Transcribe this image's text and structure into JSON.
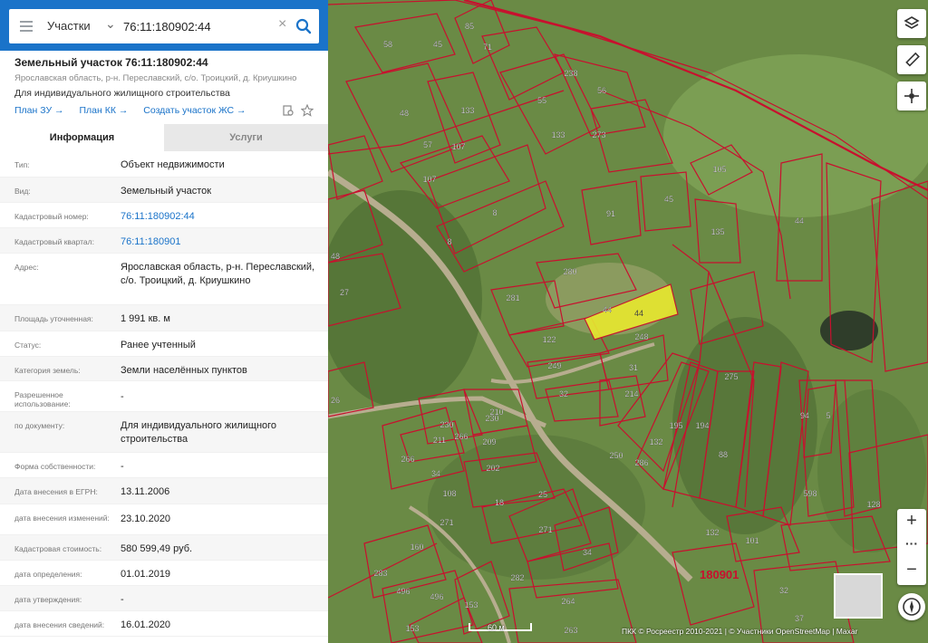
{
  "search": {
    "type_label": "Участки",
    "value": "76:11:180902:44"
  },
  "object": {
    "title": "Земельный участок 76:11:180902:44",
    "address": "Ярославская область, р-н. Переславский, с/о. Троицкий, д. Криушкино",
    "purpose": "Для индивидуального жилищного строительства",
    "links": [
      "План ЗУ →",
      "План КК →",
      "Создать участок ЖС →"
    ]
  },
  "tabs": {
    "info": "Информация",
    "services": "Услуги"
  },
  "rows": [
    {
      "key": "Тип:",
      "value": "Объект недвижимости"
    },
    {
      "key": "Вид:",
      "value": "Земельный участок"
    },
    {
      "key": "Кадастровый номер:",
      "value": "76:11:180902:44"
    },
    {
      "key": "Кадастровый квартал:",
      "value": "76:11:180901"
    },
    {
      "key": "Адрес:",
      "value": "Ярославская область, р-н. Переславский, с/о. Троицкий, д. Криушкино"
    },
    {
      "key": "Площадь уточненная:",
      "value": "1 991 кв. м"
    },
    {
      "key": "Статус:",
      "value": "Ранее учтенный"
    },
    {
      "key": "Категория земель:",
      "value": "Земли населённых пунктов"
    },
    {
      "key": "Разрешенное использование:",
      "value": "-"
    },
    {
      "key": "по документу:",
      "value": "Для индивидуального жилищного строительства"
    },
    {
      "key": "Форма собственности:",
      "value": "-"
    },
    {
      "key": "Дата внесения в ЕГРН:",
      "value": "13.11.2006"
    },
    {
      "key": "дата внесения изменений:",
      "value": "23.10.2020"
    },
    {
      "key": "Кадастровая стоимость:",
      "value": "580 599,49 руб."
    },
    {
      "key": "дата определения:",
      "value": "01.01.2019"
    },
    {
      "key": "дата утверждения:",
      "value": "-"
    },
    {
      "key": "дата внесения сведений:",
      "value": "16.01.2020"
    }
  ],
  "map": {
    "quarter_label": "180901",
    "scale_label": "60 м",
    "attribution": "ПКК © Росреестр 2010-2021 | © Участники OpenStreetMap | Maxar",
    "selected_parcel_label": "44",
    "parcel_labels": [
      "58",
      "45",
      "85",
      "71",
      "238",
      "56",
      "55",
      "48",
      "133",
      "57",
      "273",
      "133",
      "107",
      "107",
      "8",
      "8",
      "105",
      "45",
      "91",
      "135",
      "44",
      "280",
      "281",
      "44",
      "122",
      "248",
      "249",
      "31",
      "32",
      "214",
      "26",
      "27",
      "48",
      "230",
      "210",
      "230",
      "211",
      "266",
      "209",
      "266",
      "34",
      "202",
      "108",
      "271",
      "18",
      "25",
      "271",
      "34",
      "160",
      "283",
      "496",
      "282",
      "496",
      "153",
      "153",
      "264",
      "263",
      "250",
      "286",
      "132",
      "195",
      "194",
      "88",
      "275",
      "94",
      "5",
      "598",
      "128",
      "132",
      "101",
      "32",
      "37"
    ],
    "selected_color": "#e6e630",
    "boundary_color": "#c8102e"
  }
}
